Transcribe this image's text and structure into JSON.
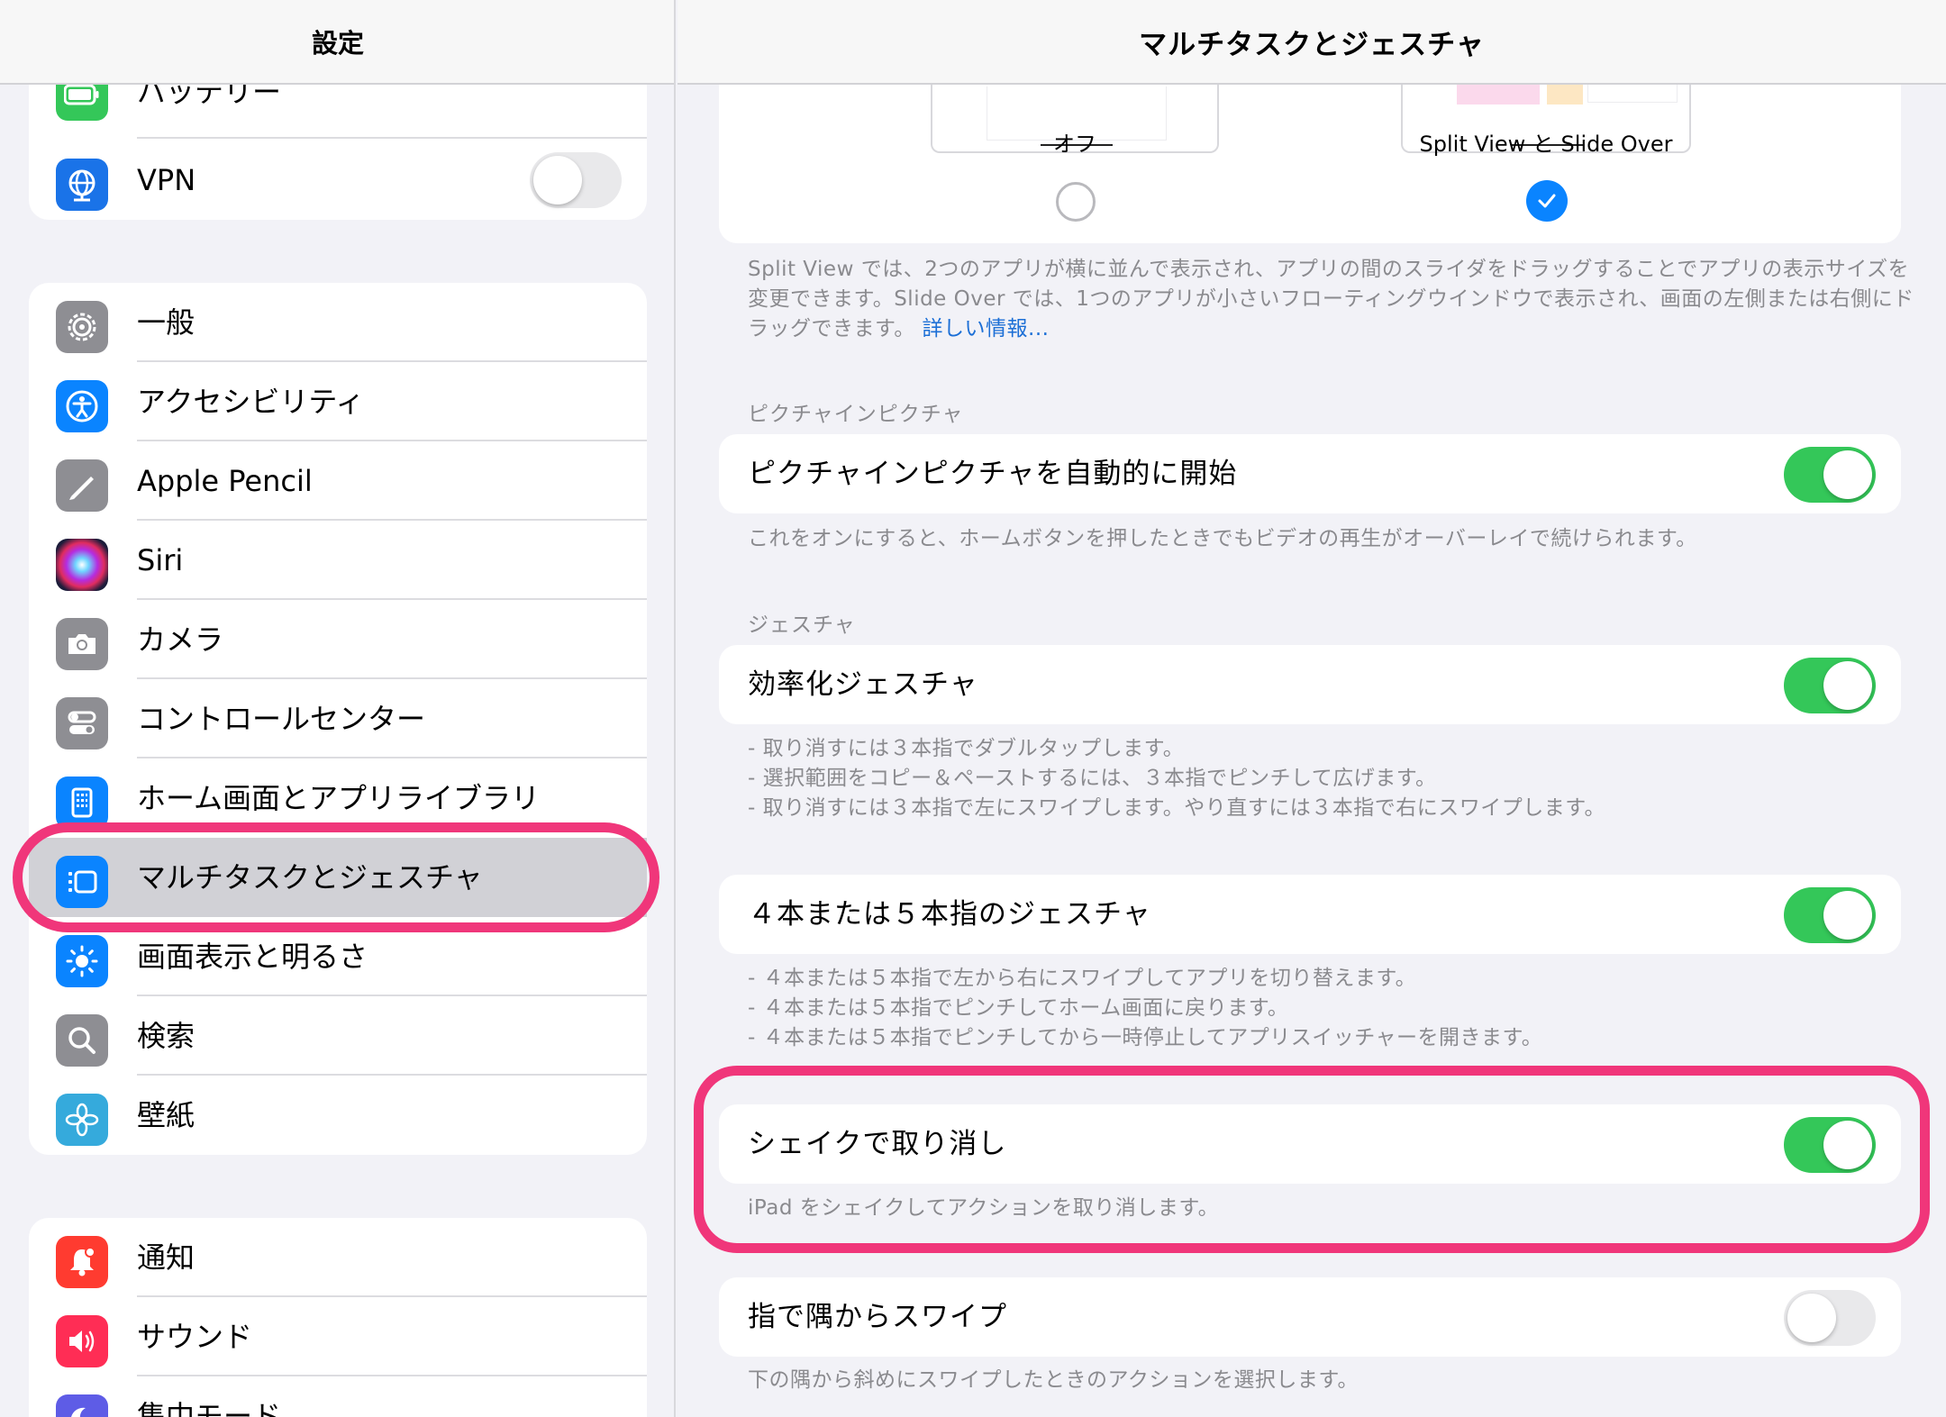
{
  "sidebar": {
    "title": "設定",
    "groups": [
      {
        "items": [
          {
            "label": "バッテリー",
            "icon": "battery-icon",
            "color": "#34c759"
          },
          {
            "label": "VPN",
            "icon": "vpn-globe-icon",
            "color": "#1a73e8",
            "toggle": false
          }
        ]
      },
      {
        "items": [
          {
            "label": "一般",
            "icon": "gear-icon",
            "color": "#8e8e93"
          },
          {
            "label": "アクセシビリティ",
            "icon": "accessibility-icon",
            "color": "#0a84ff"
          },
          {
            "label": "Apple Pencil",
            "icon": "pencil-icon",
            "color": "#8e8e93"
          },
          {
            "label": "Siri",
            "icon": "siri-icon",
            "color": "#1c1c3a"
          },
          {
            "label": "カメラ",
            "icon": "camera-icon",
            "color": "#8e8e93"
          },
          {
            "label": "コントロールセンター",
            "icon": "control-center-icon",
            "color": "#8e8e93"
          },
          {
            "label": "ホーム画面とアプリライブラリ",
            "icon": "home-screen-icon",
            "color": "#0a84ff"
          },
          {
            "label": "マルチタスクとジェスチャ",
            "icon": "multitask-icon",
            "color": "#0a84ff",
            "selected": true
          },
          {
            "label": "画面表示と明るさ",
            "icon": "brightness-icon",
            "color": "#0a84ff"
          },
          {
            "label": "検索",
            "icon": "search-icon",
            "color": "#8e8e93"
          },
          {
            "label": "壁紙",
            "icon": "wallpaper-flower-icon",
            "color": "#35aadc"
          }
        ]
      },
      {
        "items": [
          {
            "label": "通知",
            "icon": "notification-bell-icon",
            "color": "#ff3b30"
          },
          {
            "label": "サウンド",
            "icon": "speaker-icon",
            "color": "#ff2d55"
          },
          {
            "label": "集中モード",
            "icon": "moon-icon",
            "color": "#5e5ce6"
          }
        ]
      }
    ]
  },
  "main": {
    "title": "マルチタスクとジェスチャ",
    "multitask_options": {
      "off_label": "オフ",
      "off_selected": false,
      "split_label": "Split View と Slide Over",
      "split_selected": true
    },
    "multitask_note": "Split View では、2つのアプリが横に並んで表示され、アプリの間のスライダをドラッグすることでアプリの表示サイズを変更できます。Slide Over では、1つのアプリが小さいフローティングウインドウで表示され、画面の左側または右側にドラッグできます。",
    "multitask_link": "詳しい情報...",
    "pip_section": "ピクチャインピクチャ",
    "pip_label": "ピクチャインピクチャを自動的に開始",
    "pip_on": true,
    "pip_note": "これをオンにすると、ホームボタンを押したときでもビデオの再生がオーバーレイで続けられます。",
    "gesture_section": "ジェスチャ",
    "efficiency_label": "効率化ジェスチャ",
    "efficiency_on": true,
    "efficiency_notes": [
      "- 取り消すには３本指でダブルタップします。",
      "- 選択範囲をコピー＆ペーストするには、３本指でピンチして広げます。",
      "- 取り消すには３本指で左にスワイプします。やり直すには３本指で右にスワイプします。"
    ],
    "four_five_label": "４本または５本指のジェスチャ",
    "four_five_on": true,
    "four_five_notes": [
      "- ４本または５本指で左から右にスワイプしてアプリを切り替えます。",
      "- ４本または５本指でピンチしてホーム画面に戻ります。",
      "- ４本または５本指でピンチしてから一時停止してアプリスイッチャーを開きます。"
    ],
    "shake_label": "シェイクで取り消し",
    "shake_on": true,
    "shake_note": "iPad をシェイクしてアクションを取り消します。",
    "corner_label": "指で隅からスワイプ",
    "corner_on": false,
    "corner_note": "下の隅から斜めにスワイプしたときのアクションを選択します。"
  }
}
